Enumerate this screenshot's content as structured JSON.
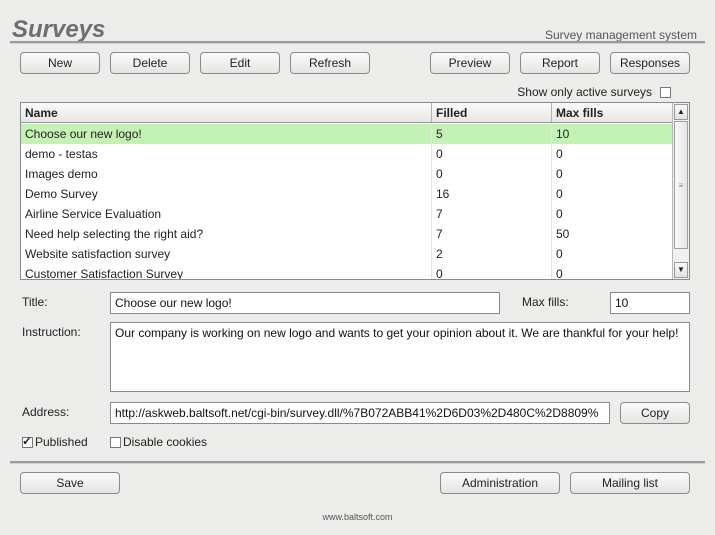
{
  "header": {
    "title": "Surveys",
    "subtitle": "Survey management system"
  },
  "toolbar": {
    "new": "New",
    "delete": "Delete",
    "edit": "Edit",
    "refresh": "Refresh",
    "preview": "Preview",
    "report": "Report",
    "responses": "Responses"
  },
  "filter": {
    "show_active_label": "Show only active surveys",
    "show_active_checked": false
  },
  "grid": {
    "columns": [
      "Name",
      "Filled",
      "Max fills"
    ],
    "selected_index": 0,
    "rows": [
      {
        "name": "Choose our new logo!",
        "filled": "5",
        "max": "10"
      },
      {
        "name": "demo - testas",
        "filled": "0",
        "max": "0"
      },
      {
        "name": "Images demo",
        "filled": "0",
        "max": "0"
      },
      {
        "name": "Demo Survey",
        "filled": "16",
        "max": "0"
      },
      {
        "name": "Airline Service Evaluation",
        "filled": "7",
        "max": "0"
      },
      {
        "name": "Need help selecting the right aid?",
        "filled": "7",
        "max": "50"
      },
      {
        "name": "Website satisfaction survey",
        "filled": "2",
        "max": "0"
      },
      {
        "name": "Customer Satisfaction Survey",
        "filled": "0",
        "max": "0"
      }
    ]
  },
  "form": {
    "title_label": "Title:",
    "title_value": "Choose our new logo!",
    "max_fills_label": "Max fills:",
    "max_fills_value": "10",
    "instruction_label": "Instruction:",
    "instruction_value": "Our company is working on new logo and wants to get your opinion about it. We are thankful for your help!",
    "address_label": "Address:",
    "address_value": "http://askweb.baltsoft.net/cgi-bin/survey.dll/%7B072ABB41%2D6D03%2D480C%2D8809%",
    "copy": "Copy",
    "published_label": "Published",
    "published_checked": true,
    "disable_cookies_label": "Disable cookies",
    "disable_cookies_checked": false
  },
  "bottom": {
    "save": "Save",
    "administration": "Administration",
    "mailing_list": "Mailing list"
  },
  "footer": {
    "text": "www.baltsoft.com"
  }
}
